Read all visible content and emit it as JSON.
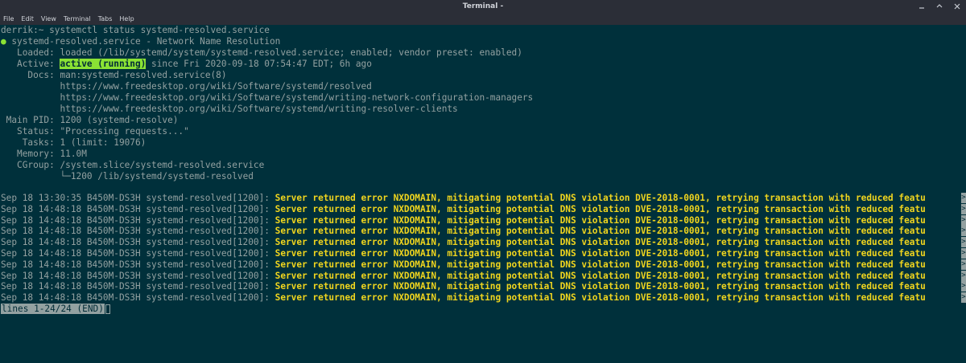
{
  "window": {
    "title": "Terminal -",
    "controls": [
      "minimize-icon",
      "maximize-icon",
      "close-icon"
    ]
  },
  "menu": [
    "File",
    "Edit",
    "View",
    "Terminal",
    "Tabs",
    "Help"
  ],
  "terminal": {
    "prompt": "derrik:~",
    "command": "systemctl status systemd-resolved.service",
    "bullet": "●",
    "unit_line": "systemd-resolved.service - Network Name Resolution",
    "loaded_label": "   Loaded:",
    "loaded_value": "loaded (/lib/systemd/system/systemd-resolved.service; enabled; vendor preset: enabled)",
    "active_label": "   Active:",
    "active_state": "active (running)",
    "active_since": "since Fri 2020-09-18 07:54:47 EDT; 6h ago",
    "docs_label": "     Docs:",
    "docs": [
      "man:systemd-resolved.service(8)",
      "https://www.freedesktop.org/wiki/Software/systemd/resolved",
      "https://www.freedesktop.org/wiki/Software/systemd/writing-network-configuration-managers",
      "https://www.freedesktop.org/wiki/Software/systemd/writing-resolver-clients"
    ],
    "pid_label": " Main PID:",
    "pid_value": "1200 (systemd-resolve)",
    "status_label": "   Status:",
    "status_value": "\"Processing requests...\"",
    "tasks_label": "    Tasks:",
    "tasks_value": "1 (limit: 19076)",
    "memory_label": "   Memory:",
    "memory_value": "11.0M",
    "cgroup_label": "   CGroup:",
    "cgroup_value": "/system.slice/systemd-resolved.service",
    "cgroup_child": "└─1200 /lib/systemd/systemd-resolved",
    "log_message": "Server returned error NXDOMAIN, mitigating potential DNS violation DVE-2018-0001, retrying transaction with reduced featu",
    "log_lines": [
      {
        "prefix": "Sep 18 13:30:35 B450M-DS3H systemd-resolved[1200]:"
      },
      {
        "prefix": "Sep 18 14:48:18 B450M-DS3H systemd-resolved[1200]:"
      },
      {
        "prefix": "Sep 18 14:48:18 B450M-DS3H systemd-resolved[1200]:"
      },
      {
        "prefix": "Sep 18 14:48:18 B450M-DS3H systemd-resolved[1200]:"
      },
      {
        "prefix": "Sep 18 14:48:18 B450M-DS3H systemd-resolved[1200]:"
      },
      {
        "prefix": "Sep 18 14:48:18 B450M-DS3H systemd-resolved[1200]:"
      },
      {
        "prefix": "Sep 18 14:48:18 B450M-DS3H systemd-resolved[1200]:"
      },
      {
        "prefix": "Sep 18 14:48:18 B450M-DS3H systemd-resolved[1200]:"
      },
      {
        "prefix": "Sep 18 14:48:18 B450M-DS3H systemd-resolved[1200]:"
      },
      {
        "prefix": "Sep 18 14:48:18 B450M-DS3H systemd-resolved[1200]:"
      }
    ],
    "truncation_marker": ">",
    "pager_status": "lines 1-24/24 (END)"
  },
  "colors": {
    "background": "#00303b",
    "text": "#93a1a1",
    "active_highlight": "#8ae234",
    "log_message": "#f0d51e"
  }
}
